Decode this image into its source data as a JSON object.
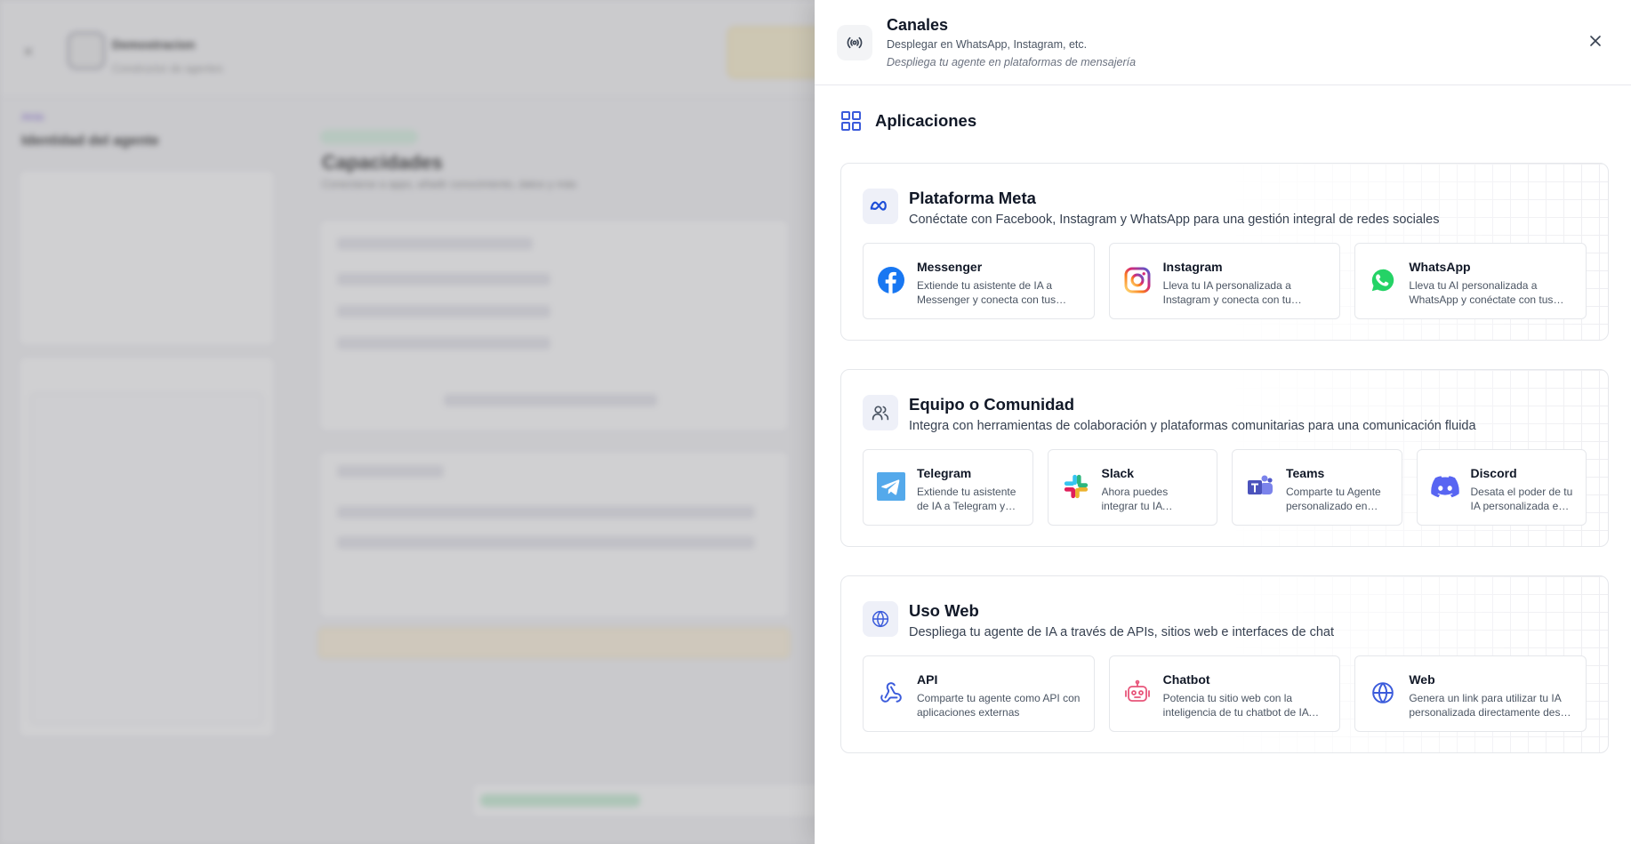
{
  "background": {
    "agent_name": "Demostracion",
    "agent_sub": "Constructor de agentes",
    "back_link": "Atrás",
    "identity_heading": "Identidad del agente",
    "capabilities_title": "Capacidades",
    "capabilities_sub": "Conectarse a apps, añadir conocimiento, datos y más"
  },
  "drawer": {
    "title": "Canales",
    "subtitle": "Desplegar en WhatsApp, Instagram, etc.",
    "description": "Despliega tu agente en plataformas de mensajería",
    "close_icon": "close-icon",
    "channel_icon": "broadcast-icon"
  },
  "apps_section": {
    "title": "Aplicaciones",
    "icon": "grid-icon"
  },
  "groups": [
    {
      "title": "Plataforma Meta",
      "description": "Conéctate con Facebook, Instagram y WhatsApp para una gestión integral de redes sociales",
      "icon": "meta-icon",
      "cards": [
        {
          "title": "Messenger",
          "description": "Extiende tu asistente de IA a Messenger y conecta con tus clientes",
          "icon": "messenger-icon"
        },
        {
          "title": "Instagram",
          "description": "Lleva tu IA personalizada a Instagram y conecta con tu audiencia",
          "icon": "instagram-icon"
        },
        {
          "title": "WhatsApp",
          "description": "Lleva tu AI personalizada a WhatsApp y conéctate con tus clientes",
          "icon": "whatsapp-icon"
        }
      ]
    },
    {
      "title": "Equipo o Comunidad",
      "description": "Integra con herramientas de colaboración y plataformas comunitarias para una comunicación fluida",
      "icon": "users-icon",
      "cards": [
        {
          "title": "Telegram",
          "description": "Extiende tu asistente de IA a Telegram y conecta",
          "icon": "telegram-icon"
        },
        {
          "title": "Slack",
          "description": "Ahora puedes integrar tu IA personalizada",
          "icon": "slack-icon"
        },
        {
          "title": "Teams",
          "description": "Comparte tu Agente personalizado en Teams",
          "icon": "teams-icon"
        },
        {
          "title": "Discord",
          "description": "Desata el poder de tu IA personalizada en Discord",
          "icon": "discord-icon"
        }
      ]
    },
    {
      "title": "Uso Web",
      "description": "Despliega tu agente de IA a través de APIs, sitios web e interfaces de chat",
      "icon": "globe-icon",
      "cards": [
        {
          "title": "API",
          "description": "Comparte tu agente como API con aplicaciones externas",
          "icon": "webhook-icon"
        },
        {
          "title": "Chatbot",
          "description": "Potencia tu sitio web con la inteligencia de tu chatbot de IA personalizado",
          "icon": "robot-icon"
        },
        {
          "title": "Web",
          "description": "Genera un link para utilizar tu IA personalizada directamente desde el navegador",
          "icon": "globe-icon"
        }
      ]
    }
  ],
  "colors": {
    "accent": "#3b5bdb",
    "messenger": "#1877f2",
    "whatsapp": "#25d366",
    "telegram": "#54a9eb",
    "teams": "#5b5fc7",
    "discord": "#5865f2",
    "chatbot": "#e8557a"
  }
}
